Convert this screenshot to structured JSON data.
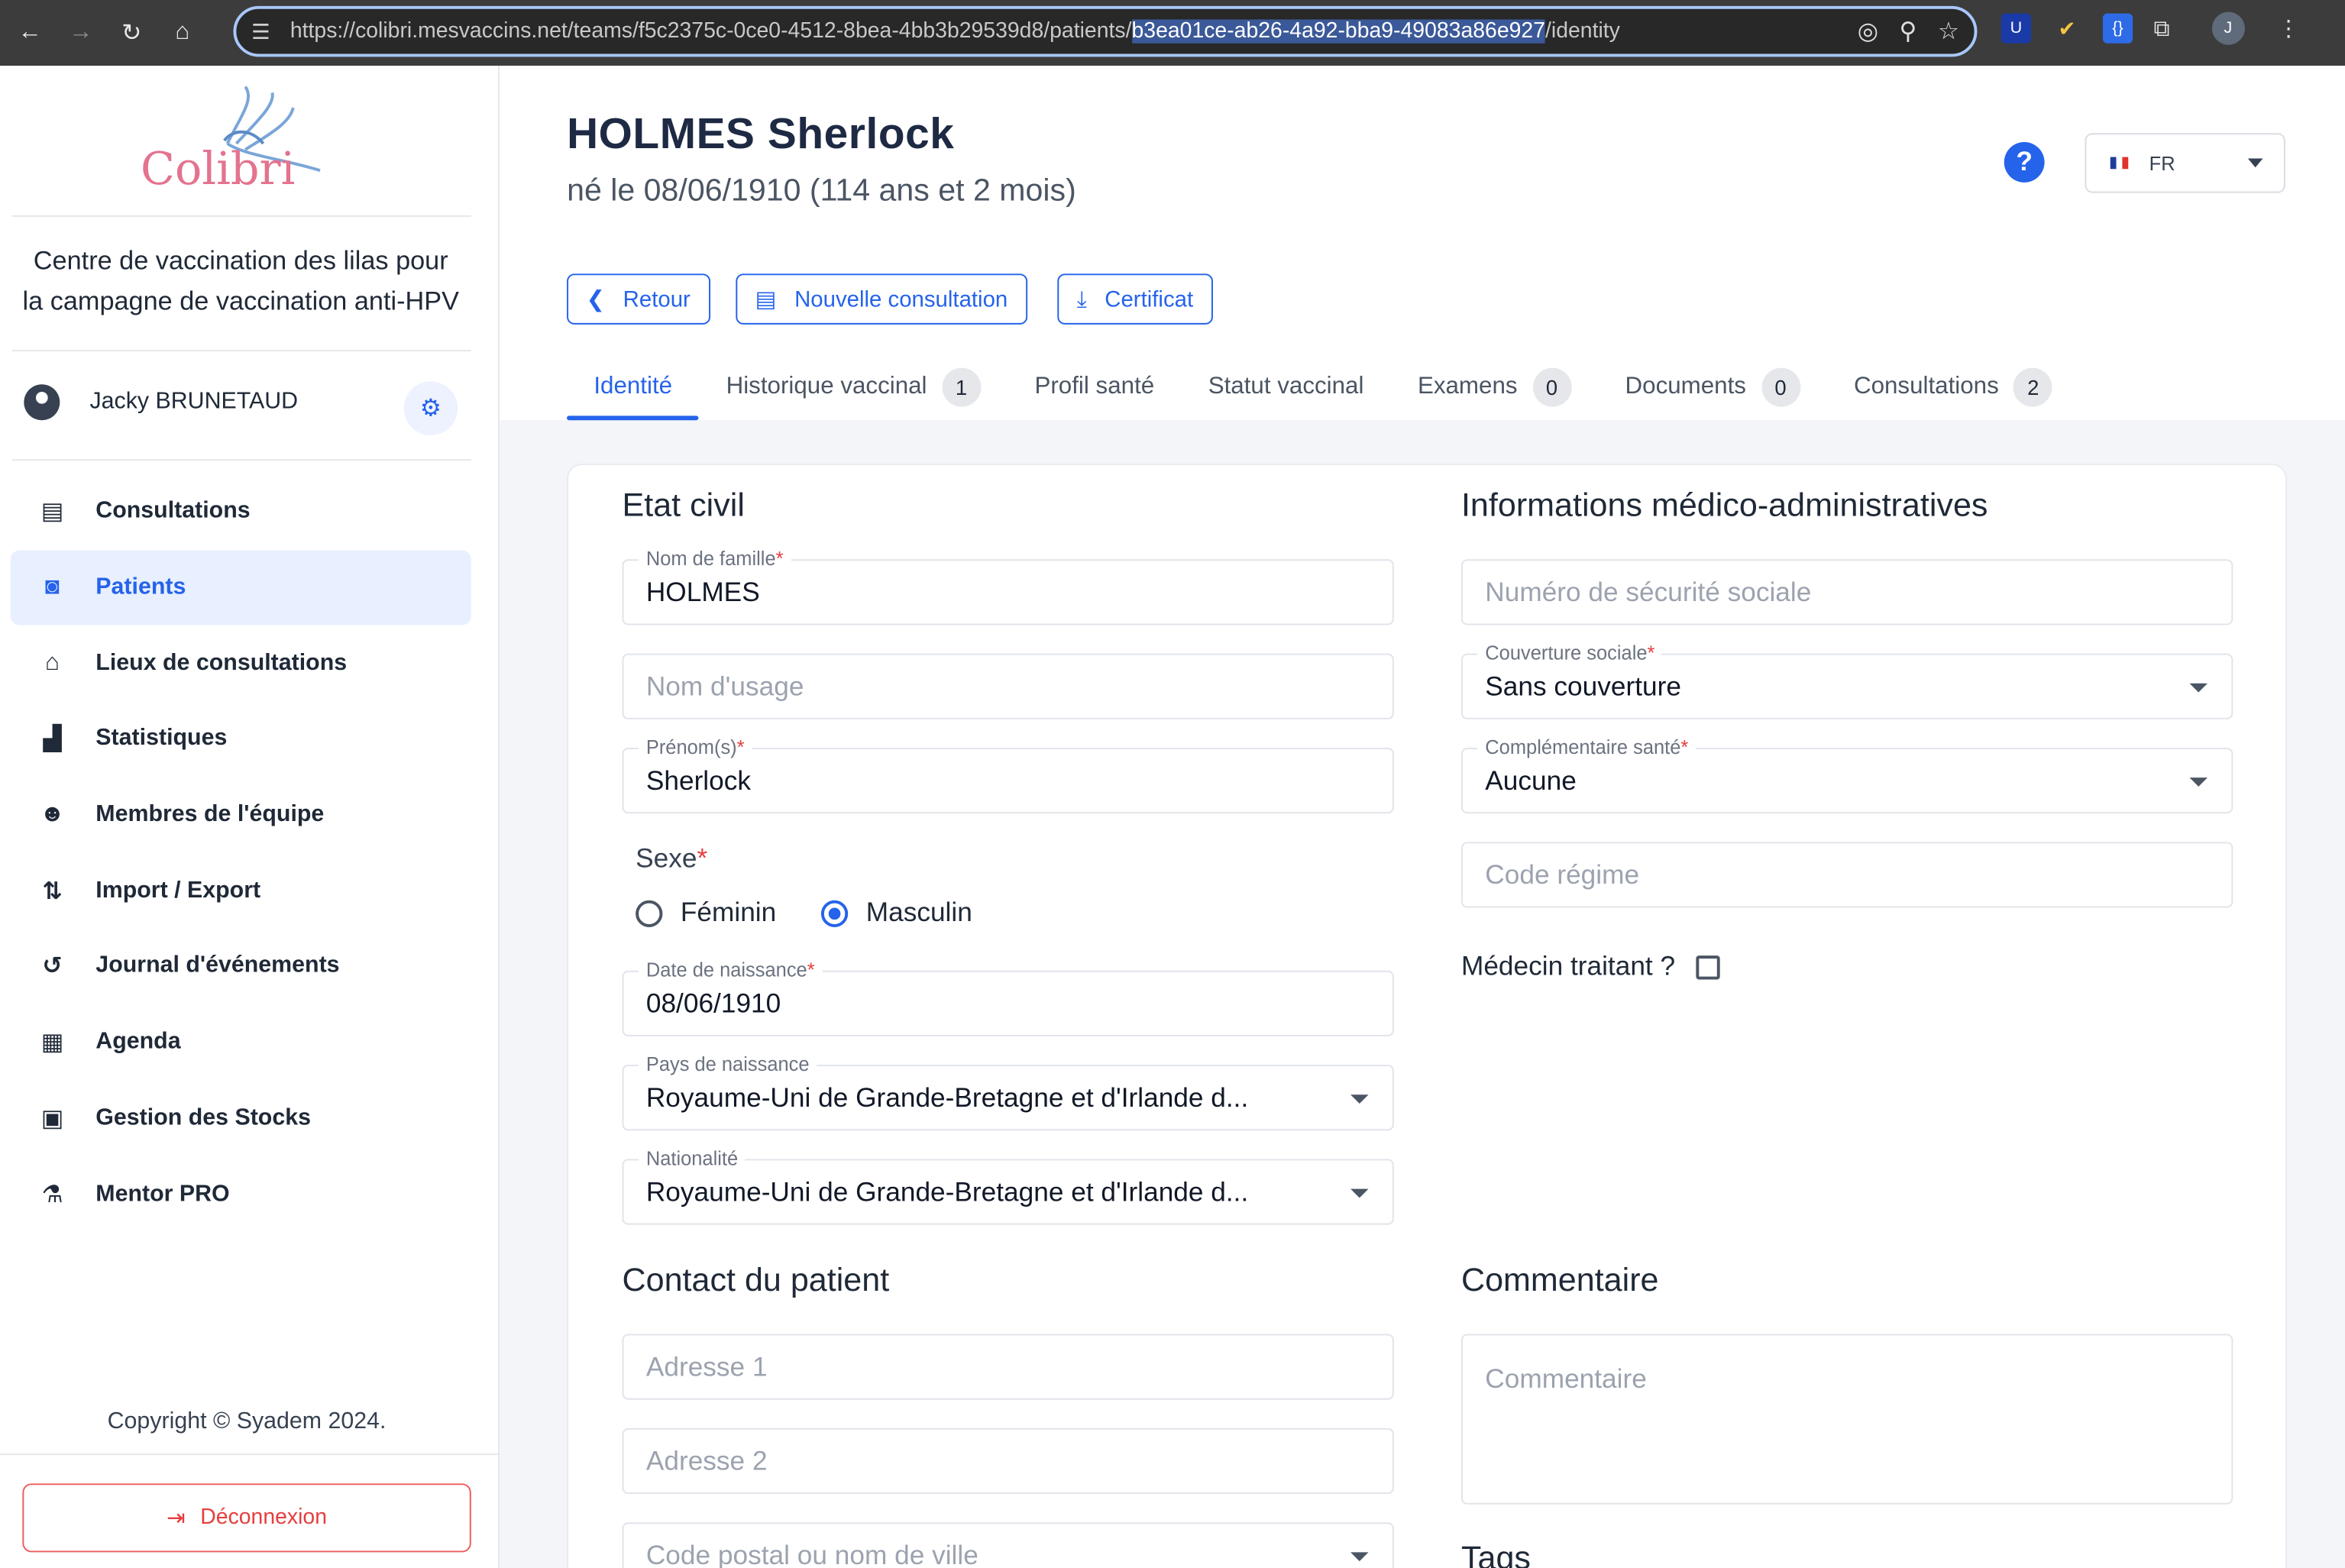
{
  "browser": {
    "url_prefix": "https://colibri.mesvaccins.net/teams/f5c2375c-0ce0-4512-8bea-4bb3b29539d8/patients/",
    "url_highlight": "b3ea01ce-ab26-4a92-bba9-49083a86e927",
    "url_suffix": "/identity",
    "profile_initial": "J"
  },
  "sidebar": {
    "logo_text": "Colibri",
    "centre_line1": "Centre de vaccination des lilas pour",
    "centre_line2": "la campagne de vaccination anti-HPV",
    "user_name": "Jacky BRUNETAUD",
    "menu": [
      {
        "label": "Consultations",
        "icon": "clipboard-icon"
      },
      {
        "label": "Patients",
        "icon": "patient-badge-icon",
        "active": true
      },
      {
        "label": "Lieux de consultations",
        "icon": "home-plus-icon"
      },
      {
        "label": "Statistiques",
        "icon": "bar-chart-icon"
      },
      {
        "label": "Membres de l'équipe",
        "icon": "team-icon"
      },
      {
        "label": "Import / Export",
        "icon": "arrows-updown-icon"
      },
      {
        "label": "Journal d'événements",
        "icon": "history-icon"
      },
      {
        "label": "Agenda",
        "icon": "calendar-icon"
      },
      {
        "label": "Gestion des Stocks",
        "icon": "archive-icon"
      },
      {
        "label": "Mentor PRO",
        "icon": "vaccine-icon"
      }
    ],
    "copyright": "Copyright © Syadem 2024.",
    "logout": "Déconnexion"
  },
  "header": {
    "patient_name": "HOLMES Sherlock",
    "patient_sub": "né le 08/06/1910 (114 ans et 2 mois)",
    "help": "?",
    "language": "FR",
    "buttons": {
      "back": "Retour",
      "new_consultation": "Nouvelle consultation",
      "certificate": "Certificat"
    },
    "tabs": [
      {
        "label": "Identité",
        "active": true
      },
      {
        "label": "Historique vaccinal",
        "badge": "1"
      },
      {
        "label": "Profil santé"
      },
      {
        "label": "Statut vaccinal"
      },
      {
        "label": "Examens",
        "badge": "0"
      },
      {
        "label": "Documents",
        "badge": "0"
      },
      {
        "label": "Consultations",
        "badge": "2"
      }
    ]
  },
  "etat_civil": {
    "title": "Etat civil",
    "nom_label": "Nom de famille",
    "nom_value": "HOLMES",
    "usage_placeholder": "Nom d'usage",
    "prenom_label": "Prénom(s)",
    "prenom_value": "Sherlock",
    "sexe_label": "Sexe",
    "sexe_f": "Féminin",
    "sexe_m": "Masculin",
    "naissance_label": "Date de naissance",
    "naissance_value": "08/06/1910",
    "pays_label": "Pays de naissance",
    "pays_value": "Royaume-Uni de Grande-Bretagne et d'Irlande d...",
    "nationalite_label": "Nationalité",
    "nationalite_value": "Royaume-Uni de Grande-Bretagne et d'Irlande d..."
  },
  "medico": {
    "title": "Informations médico-administratives",
    "secu_placeholder": "Numéro de sécurité sociale",
    "couverture_label": "Couverture sociale",
    "couverture_value": "Sans couverture",
    "complementaire_label": "Complémentaire santé",
    "complementaire_value": "Aucune",
    "regime_placeholder": "Code régime",
    "medecin_label": "Médecin traitant ?"
  },
  "contact": {
    "title": "Contact du patient",
    "adresse1": "Adresse 1",
    "adresse2": "Adresse 2",
    "ville": "Code postal ou nom de ville"
  },
  "commentaire": {
    "title": "Commentaire",
    "placeholder": "Commentaire"
  },
  "tags": {
    "title": "Tags"
  },
  "colors": {
    "accent": "#2563eb",
    "danger": "#e53e3e",
    "logo": "#e3738f"
  }
}
